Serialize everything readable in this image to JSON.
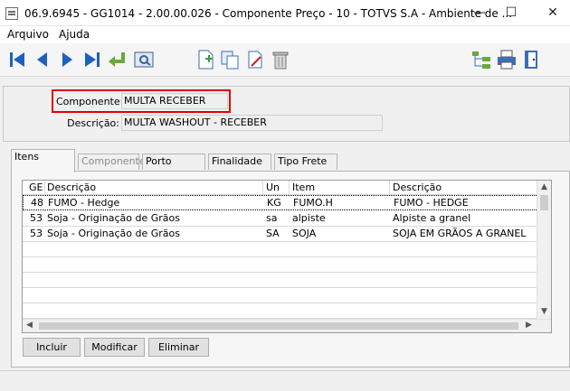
{
  "window": {
    "title": "06.9.6945 - GG1014 - 2.00.00.026 - Componente Preço - 10 - TOTVS S.A - Ambiente de ...",
    "minimize": "—",
    "maximize": "☐",
    "close": "✕"
  },
  "menu": {
    "items": [
      "Arquivo",
      "Ajuda"
    ]
  },
  "toolbar": {
    "buttons": [
      "first-record-icon",
      "previous-record-icon",
      "next-record-icon",
      "last-record-icon",
      "return-icon",
      "search-icon",
      "new-record-icon",
      "copy-record-icon",
      "edit-record-icon",
      "delete-record-icon",
      "hierarchy-icon",
      "print-icon",
      "exit-icon"
    ]
  },
  "form": {
    "componente_label": "Componente:",
    "componente_value": "MULTA RECEBER",
    "descricao_label": "Descrição:",
    "descricao_value": "MULTA WASHOUT - RECEBER"
  },
  "tabs": [
    "Itens",
    "Componente:",
    "Porto",
    "Finalidade",
    "Tipo Frete"
  ],
  "grid": {
    "columns": [
      "GE",
      "Descrição",
      "Un",
      "Item",
      "Descrição"
    ],
    "rows": [
      [
        "48",
        "FUMO - Hedge",
        "KG",
        "FUMO.H",
        "FUMO - HEDGE"
      ],
      [
        "53",
        "Soja - Originação de Grãos",
        "sa",
        "alpiste",
        "Alpiste a granel"
      ],
      [
        "53",
        "Soja - Originação de Grãos",
        "SA",
        "SOJA",
        "SOJA EM GRÃOS A GRANEL"
      ]
    ]
  },
  "buttons": {
    "incluir": "Incluir",
    "modificar": "Modificar",
    "eliminar": "Eliminar"
  },
  "colors": {
    "highlight_border": "#e00000",
    "toolbar_icon_blue": "#1f5fbf"
  }
}
